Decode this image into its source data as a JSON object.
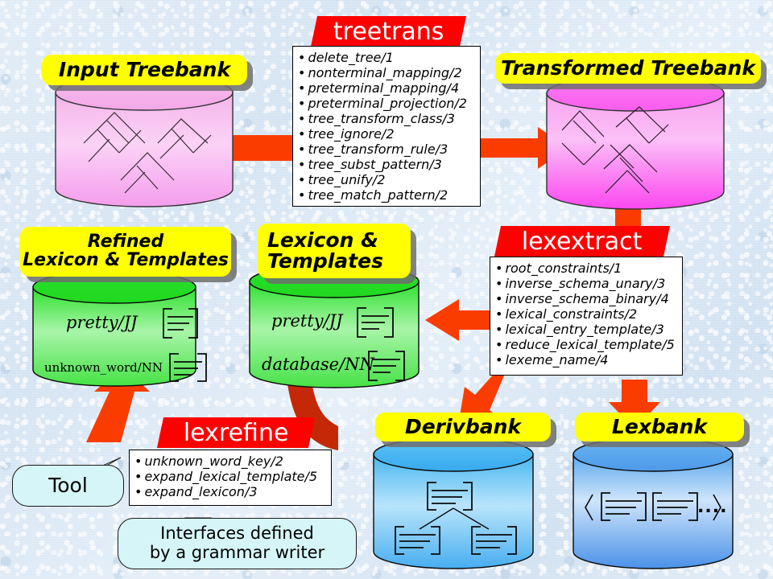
{
  "diagram": {
    "title_nodes": {
      "input_treebank": "Input Treebank",
      "transformed_treebank": "Transformed Treebank",
      "refined_lexicon": "Refined\nLexicon & Templates",
      "refined_lexicon_line1": "Refined",
      "refined_lexicon_line2": "Lexicon & Templates",
      "lexicon_templates_line1": "Lexicon &",
      "lexicon_templates_line2": "Templates",
      "derivbank": "Derivbank",
      "lexbank": "Lexbank"
    },
    "tools": [
      {
        "name": "treetrans",
        "predicates": [
          "delete_tree/1",
          "nonterminal_mapping/2",
          "preterminal_mapping/4",
          "preterminal_projection/2",
          "tree_transform_class/3",
          "tree_ignore/2",
          "tree_transform_rule/3",
          "tree_subst_pattern/3",
          "tree_unify/2",
          "tree_match_pattern/2"
        ]
      },
      {
        "name": "lexextract",
        "predicates": [
          "root_constraints/1",
          "inverse_schema_unary/3",
          "inverse_schema_binary/4",
          "lexical_constraints/2",
          "lexical_entry_template/3",
          "reduce_lexical_template/5",
          "lexeme_name/4"
        ]
      },
      {
        "name": "lexrefine",
        "predicates": [
          "unknown_word_key/2",
          "expand_lexical_template/5",
          "expand_lexicon/3"
        ]
      }
    ],
    "cylinder_contents": {
      "refined_entry_1": "pretty/JJ",
      "refined_entry_2": "unknown_word/NN",
      "lexicon_entry_1": "pretty/JJ",
      "lexicon_entry_2": "database/NN",
      "lexbank_ellipsis": "...."
    },
    "callouts": {
      "tool": "Tool",
      "interfaces_line1": "Interfaces defined",
      "interfaces_line2": "by a grammar writer"
    },
    "colors": {
      "banner_red": "#fd0100",
      "arrow_orange": "#fa3c00",
      "arrow_dark_red": "#c42806",
      "label_yellow": "#ffff00",
      "treebank_pink": "#f7a8ec",
      "treebank_magenta": "#fa5ef2",
      "lexicon_green": "#33e033",
      "bank_blue": "#4aa8ef",
      "callout_cyan": "#d6f5f8",
      "background_blue": "#dce9f5"
    },
    "bullet": "•"
  }
}
